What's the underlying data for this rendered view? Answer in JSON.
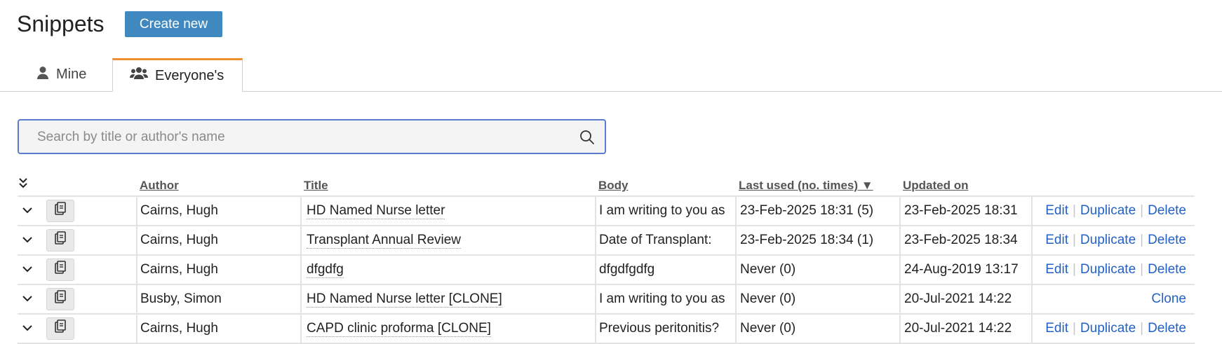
{
  "page": {
    "title": "Snippets",
    "create_label": "Create new"
  },
  "tabs": [
    {
      "label": "Mine",
      "icon": "user-icon",
      "active": false
    },
    {
      "label": "Everyone's",
      "icon": "users-icon",
      "active": true
    }
  ],
  "search": {
    "placeholder": "Search by title or author's name",
    "value": ""
  },
  "table": {
    "headers": {
      "author": "Author",
      "title": "Title",
      "body": "Body",
      "last_used": "Last used (no. times) ▼",
      "updated": "Updated on"
    },
    "rows": [
      {
        "author": "Cairns, Hugh",
        "title": "HD Named Nurse letter",
        "body": " I am writing to you as",
        "last_used": "23-Feb-2025 18:31 (5)",
        "updated": "23-Feb-2025 18:31",
        "actions": [
          "Edit",
          "Duplicate",
          "Delete"
        ]
      },
      {
        "author": "Cairns, Hugh",
        "title": "Transplant Annual Review",
        "body": " Date of Transplant:",
        "last_used": "23-Feb-2025 18:34 (1)",
        "updated": "23-Feb-2025 18:34",
        "actions": [
          "Edit",
          "Duplicate",
          "Delete"
        ]
      },
      {
        "author": "Cairns, Hugh",
        "title": "dfgdfg",
        "body": "dfgdfgdfg",
        "last_used": "Never (0)",
        "updated": "24-Aug-2019 13:17",
        "actions": [
          "Edit",
          "Duplicate",
          "Delete"
        ]
      },
      {
        "author": "Busby, Simon",
        "title": "HD Named Nurse letter [CLONE]",
        "body": " I am writing to you as",
        "last_used": "Never (0)",
        "updated": "20-Jul-2021 14:22",
        "actions": [
          "Clone"
        ]
      },
      {
        "author": "Cairns, Hugh",
        "title": "CAPD clinic proforma [CLONE]",
        "body": "Previous peritonitis?",
        "last_used": "Never (0)",
        "updated": "20-Jul-2021 14:22",
        "actions": [
          "Edit",
          "Duplicate",
          "Delete"
        ]
      }
    ]
  },
  "colors": {
    "primary_button": "#3f89c0",
    "active_tab_accent": "#ef8e2d",
    "link": "#2361c4",
    "search_border": "#5c7ccd"
  }
}
